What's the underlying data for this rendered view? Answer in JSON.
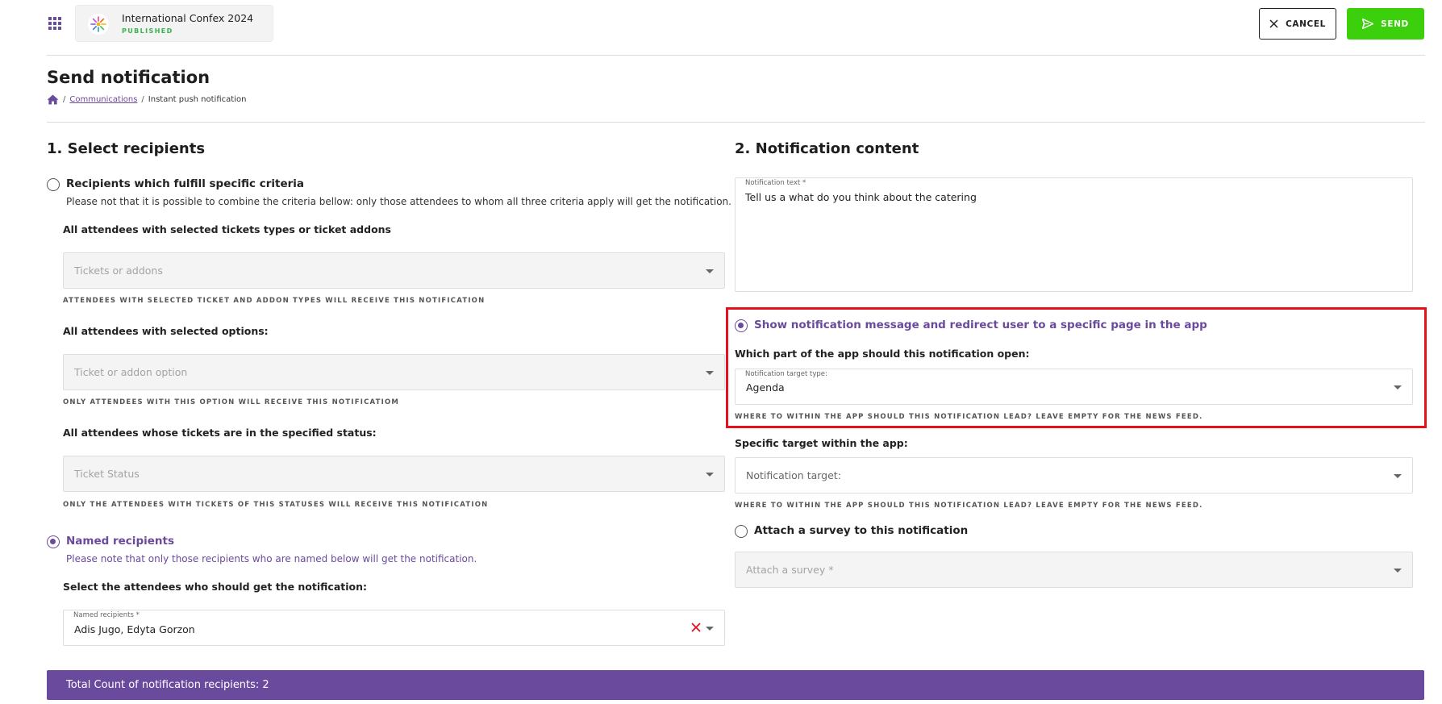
{
  "event": {
    "name": "International Confex 2024",
    "status": "PUBLISHED"
  },
  "toolbar": {
    "cancel_label": "CANCEL",
    "send_label": "SEND"
  },
  "page": {
    "title": "Send notification",
    "breadcrumb": {
      "link": "Communications",
      "separator": "/",
      "current": "Instant push notification"
    }
  },
  "recipients": {
    "section_title": "1. Select recipients",
    "criteria_option": {
      "label": "Recipients which fulfill specific criteria",
      "help": "Please not that it is possible to combine the criteria bellow: only those attendees to whom all three criteria apply will get the notification.",
      "selected": false
    },
    "tickets": {
      "heading": "All attendees with selected tickets types or ticket addons",
      "placeholder": "Tickets or addons",
      "hint": "Attendees with selected ticket and addon types will receive this notification"
    },
    "options": {
      "heading": "All attendees with selected options:",
      "placeholder": "Ticket or addon option",
      "hint": "Only attendees with this option will receive this notificatiom"
    },
    "status": {
      "heading": "All attendees whose tickets are in the specified status:",
      "placeholder": "Ticket Status",
      "hint": "Only the attendees with tickets of this statuses will receive this notification"
    },
    "named_option": {
      "label": "Named recipients",
      "help": "Please note that only those recipients who are named below will get the notification.",
      "selected": true
    },
    "named": {
      "heading": "Select the attendees who should get the notification:",
      "float_label": "Named recipients *",
      "value": "Adis Jugo, Edyta Gorzon"
    }
  },
  "content": {
    "section_title": "2. Notification content",
    "text_field": {
      "label": "Notification text *",
      "value": "Tell us a what do you think about the catering"
    },
    "redirect_option": {
      "label": "Show notification message and redirect user to a specific page in the app",
      "selected": true
    },
    "target_type": {
      "heading": "Which part of the app should this notification open:",
      "float_label": "Notification target type:",
      "value": "Agenda",
      "hint": "Where to within the app should this notification lead? Leave empty for the news feed."
    },
    "specific_target": {
      "heading": "Specific target within the app:",
      "placeholder": "Notification target:",
      "hint": "Where to within the app should this notification lead? Leave empty for the news feed."
    },
    "survey_option": {
      "label": "Attach a survey to this notification",
      "selected": false,
      "placeholder": "Attach a survey *"
    }
  },
  "footer": {
    "total_label": "Total Count of notification recipients: 2"
  },
  "colors": {
    "accent": "#6a4a9c",
    "send": "#3ccf0c",
    "highlight": "#e8101b",
    "published": "#37b24d"
  }
}
